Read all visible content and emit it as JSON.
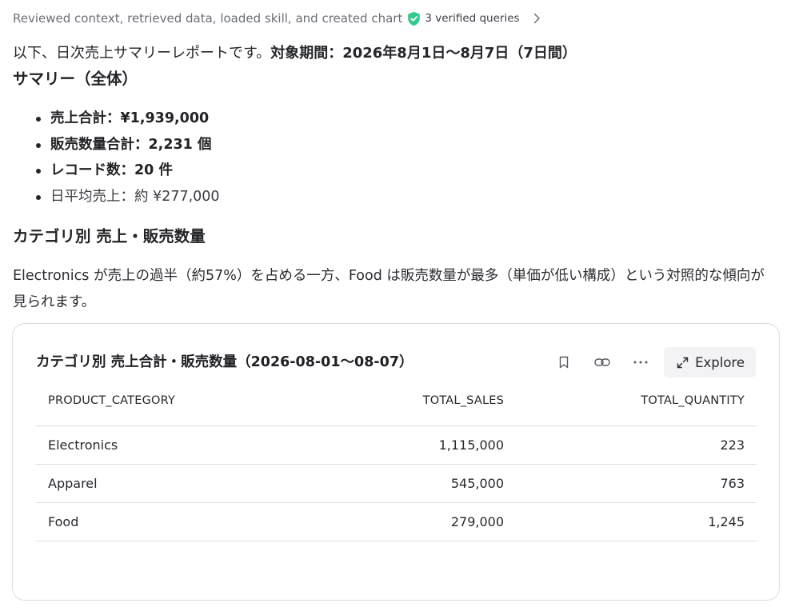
{
  "status": {
    "text": "Reviewed context, retrieved data, loaded skill, and created chart",
    "verified_label": "3 verified queries",
    "verified_color": "#34c98e"
  },
  "intro": {
    "text": "以下、日次売上サマリーレポートです。",
    "period": "対象期間：2026年8月1日〜8月7日（7日間）"
  },
  "summary": {
    "heading": "サマリー（全体）",
    "items": [
      "売上合計：¥1,939,000",
      "販売数量合計：2,231 個",
      "レコード数：20 件",
      "日平均売上：約 ¥277,000"
    ]
  },
  "category": {
    "heading": "カテゴリ別 売上・販売数量",
    "paragraph": "Electronics が売上の過半（約57%）を占める一方、Food は販売数量が最多（単価が低い構成）という対照的な傾向が見られます。"
  },
  "card": {
    "title": "カテゴリ別 売上合計・販売数量（2026-08-01〜08-07）",
    "explore_label": "Explore",
    "tools": [
      "bookmark-icon",
      "link-icon",
      "more-icon",
      "expand-icon"
    ]
  },
  "table": {
    "columns": [
      "PRODUCT_CATEGORY",
      "TOTAL_SALES",
      "TOTAL_QUANTITY"
    ],
    "rows": [
      [
        "Electronics",
        "1,115,000",
        "223"
      ],
      [
        "Apparel",
        "545,000",
        "763"
      ],
      [
        "Food",
        "279,000",
        "1,245"
      ]
    ]
  }
}
